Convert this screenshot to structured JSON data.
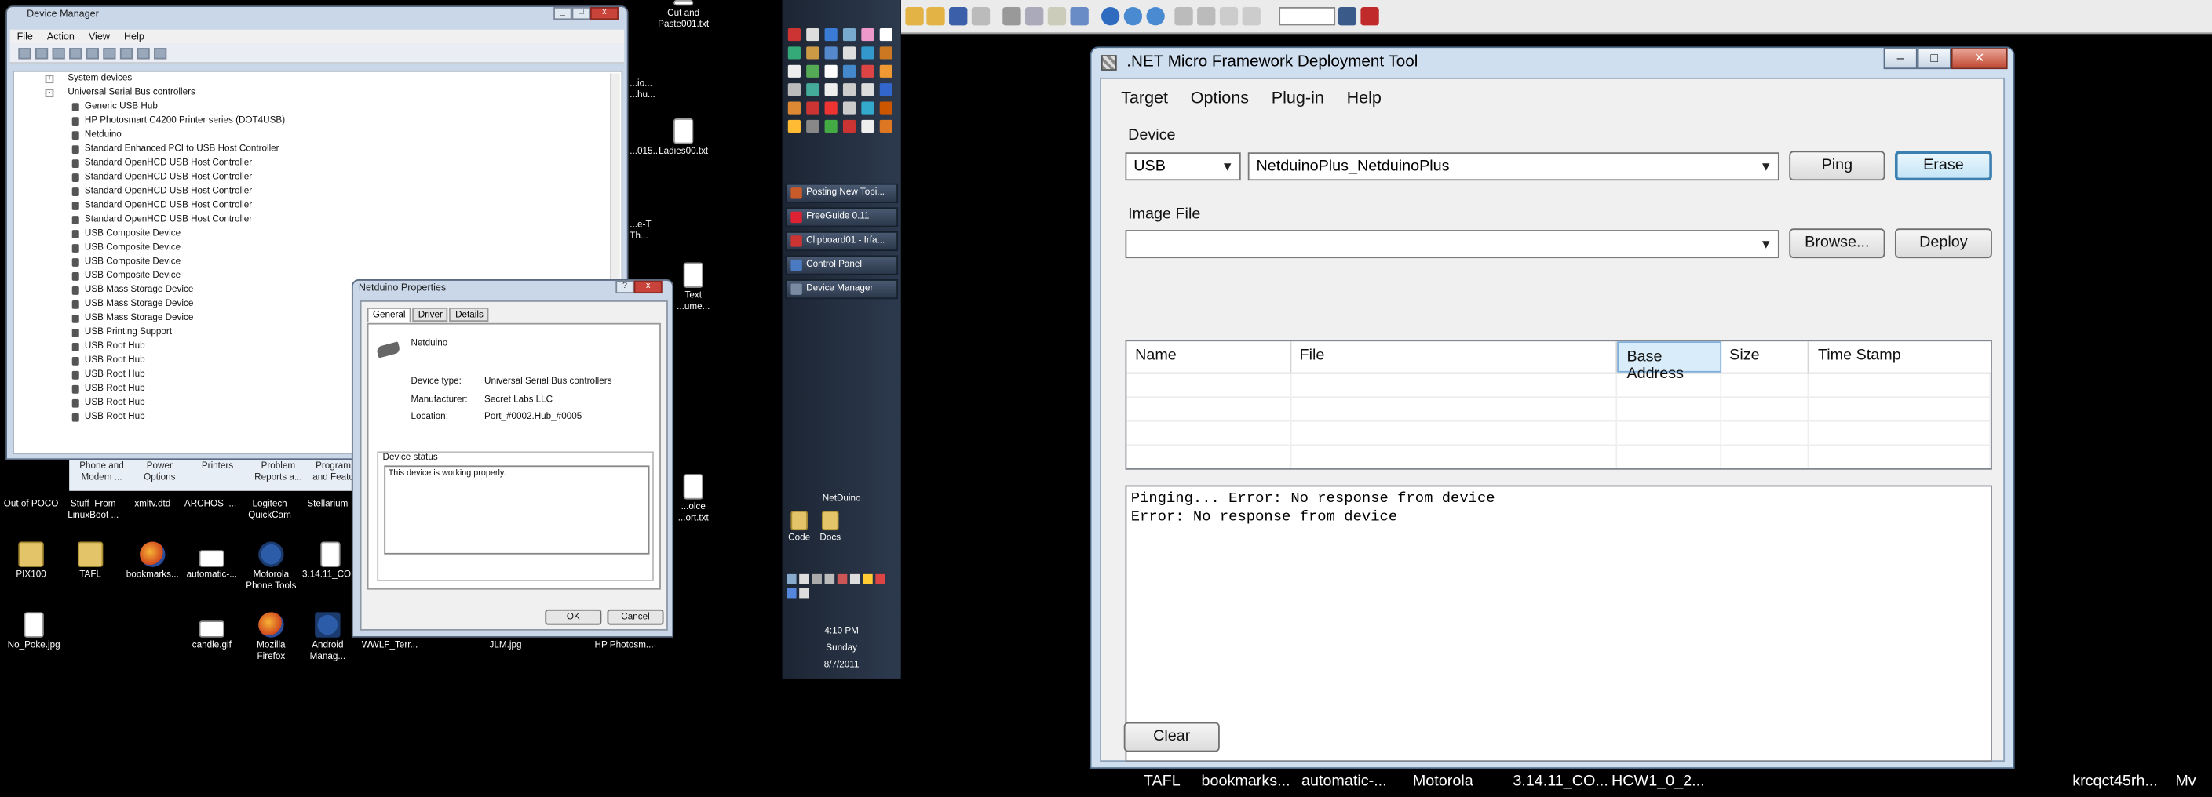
{
  "device_manager": {
    "title": "Device Manager",
    "menu": [
      "File",
      "Action",
      "View",
      "Help"
    ],
    "tree": {
      "system_devices": "System devices",
      "usb_controllers": "Universal Serial Bus controllers",
      "devices": [
        "Generic USB Hub",
        "HP Photosmart C4200 Printer series (DOT4USB)",
        "Netduino",
        "Standard Enhanced PCI to USB Host Controller",
        "Standard OpenHCD USB Host Controller",
        "Standard OpenHCD USB Host Controller",
        "Standard OpenHCD USB Host Controller",
        "Standard OpenHCD USB Host Controller",
        "Standard OpenHCD USB Host Controller",
        "USB Composite Device",
        "USB Composite Device",
        "USB Composite Device",
        "USB Composite Device",
        "USB Mass Storage Device",
        "USB Mass Storage Device",
        "USB Mass Storage Device",
        "USB Printing Support",
        "USB Root Hub",
        "USB Root Hub",
        "USB Root Hub",
        "USB Root Hub",
        "USB Root Hub",
        "USB Root Hub"
      ]
    }
  },
  "control_panel_strip": {
    "items": [
      "Phone and Modem ...",
      "Power Options",
      "Printers",
      "Problem Reports a...",
      "Program and Featu"
    ]
  },
  "desktop_icons": {
    "top_right": [
      "Cut and Paste001.txt",
      "Ladies00.txt"
    ],
    "row1": [
      "Out of POCO",
      "Stuff_From LinuxBoot ...",
      "xmltv.dtd",
      "ARCHOS_...",
      "Logitech QuickCam",
      "Stellarium"
    ],
    "row2": [
      "PIX100",
      "TAFL",
      "bookmarks...",
      "automatic-...",
      "Motorola Phone Tools",
      "3.14.11_CO..."
    ],
    "row3": [
      "No_Poke.jpg",
      "candle.gif",
      "Mozilla Firefox",
      "Android Manag...",
      "WWLF_Terr...",
      "JLM.jpg",
      "HP Photosm..."
    ],
    "partial": [
      "Text ...ume...",
      "...olce ...ort.txt",
      "...e-T Th...",
      "...io... ...hu...",
      "...015..."
    ]
  },
  "properties_dialog": {
    "title": "Netduino Properties",
    "tabs": [
      "General",
      "Driver",
      "Details"
    ],
    "device_name": "Netduino",
    "device_type_label": "Device type:",
    "device_type_value": "Universal Serial Bus controllers",
    "manufacturer_label": "Manufacturer:",
    "manufacturer_value": "Secret Labs LLC",
    "location_label": "Location:",
    "location_value": "Port_#0002.Hub_#0005",
    "status_label": "Device status",
    "status_text": "This device is working properly.",
    "ok": "OK",
    "cancel": "Cancel"
  },
  "taskbar": {
    "items": [
      "Posting New Topi...",
      "FreeGuide 0.11",
      "Clipboard01 - Irfa...",
      "Control Panel",
      "Device Manager"
    ],
    "netduino_label": "NetDuino",
    "folders": [
      "Code",
      "Docs"
    ],
    "time": "4:10 PM",
    "day": "Sunday",
    "date": "8/7/2011"
  },
  "mfdeploy": {
    "title": ".NET Micro Framework Deployment Tool",
    "menu": [
      "Target",
      "Options",
      "Plug-in",
      "Help"
    ],
    "device_group": "Device",
    "transport": "USB",
    "device": "NetduinoPlus_NetduinoPlus",
    "ping": "Ping",
    "erase": "Erase",
    "image_group": "Image File",
    "image_path": "",
    "browse": "Browse...",
    "deploy": "Deploy",
    "columns": [
      "Name",
      "File",
      "Base Address",
      "Size",
      "Time Stamp"
    ],
    "output": [
      "Pinging... Error: No response from device",
      "Error: No response from device"
    ],
    "clear": "Clear"
  },
  "right_taskbar": {
    "items": [
      "TAFL",
      "bookmarks...",
      "automatic-...",
      "Motorola",
      "3.14.11_CO...",
      "HCW1_0_2...",
      "krcqct45rh...",
      "Mv"
    ]
  },
  "colors": {
    "desktop": "#000000",
    "window_frame": "#cfdff0",
    "selected_header": "#d8ecf9",
    "focused_button": "#3c7fb1"
  }
}
